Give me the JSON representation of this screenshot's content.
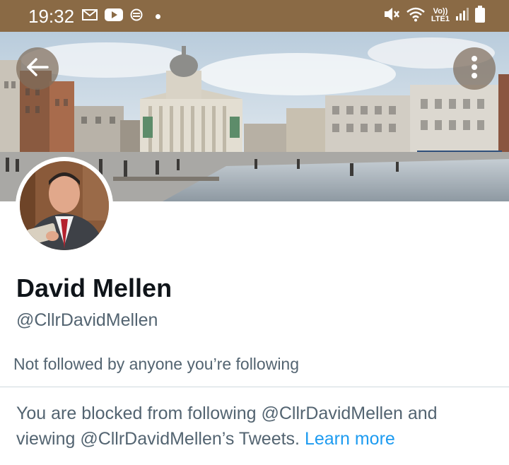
{
  "status_bar": {
    "time": "19:32",
    "volte_top": "Vo))",
    "volte_bottom": "LTE1",
    "icons": [
      "mail-icon",
      "youtube-icon",
      "vpn-icon",
      "notification-dot-icon",
      "mute-icon",
      "wifi-icon",
      "signal-icon",
      "battery-icon"
    ]
  },
  "header": {
    "back_icon": "arrow-left-icon",
    "more_icon": "more-vertical-icon"
  },
  "profile": {
    "name": "David Mellen",
    "handle": "@CllrDavidMellen",
    "followers_note": "Not followed by anyone you’re following"
  },
  "blocked_notice": {
    "text": "You are blocked from following @CllrDavidMellen and viewing @CllrDavidMellen’s Tweets.",
    "link_label": "Learn more"
  },
  "colors": {
    "status_bar": "#8a6a45",
    "link": "#1d9bf0",
    "secondary_text": "#536471",
    "primary_text": "#0f1419"
  }
}
